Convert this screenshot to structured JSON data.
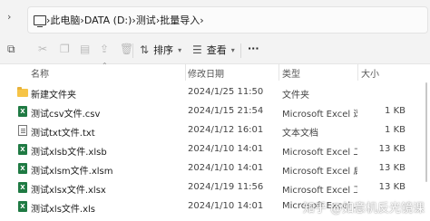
{
  "address_bar": {
    "segments": [
      "此电脑",
      "DATA (D:)",
      "测试",
      "批量导入"
    ]
  },
  "toolbar": {
    "sort_label": "排序",
    "view_label": "查看",
    "more_label": "···"
  },
  "columns": {
    "name": "名称",
    "date": "修改日期",
    "type": "类型",
    "size": "大小"
  },
  "files": [
    {
      "name": "新建文件夹",
      "date": "2024/1/25 11:50",
      "type": "文件夹",
      "size": "",
      "icon": "folder-icon"
    },
    {
      "name": "测试csv文件.csv",
      "date": "2024/1/15 21:54",
      "type": "Microsoft Excel 逗...",
      "size": "1 KB",
      "icon": "excel-csv-icon"
    },
    {
      "name": "测试txt文件.txt",
      "date": "2024/1/12 16:01",
      "type": "文本文档",
      "size": "1 KB",
      "icon": "text-file-icon"
    },
    {
      "name": "测试xlsb文件.xlsb",
      "date": "2024/1/10 14:01",
      "type": "Microsoft Excel 二...",
      "size": "13 KB",
      "icon": "excel-xlsb-icon"
    },
    {
      "name": "测试xlsm文件.xlsm",
      "date": "2024/1/10 14:01",
      "type": "Microsoft Excel 启...",
      "size": "13 KB",
      "icon": "excel-xlsm-icon"
    },
    {
      "name": "测试xlsx文件.xlsx",
      "date": "2024/1/19 11:56",
      "type": "Microsoft Excel 工...",
      "size": "13 KB",
      "icon": "excel-xlsx-icon"
    },
    {
      "name": "测试xls文件.xls",
      "date": "2024/1/10 14:01",
      "type": "Microsoft Excel ...",
      "size": "",
      "icon": "excel-xls-icon"
    }
  ],
  "watermark": "知乎 @如意机反光镜课"
}
